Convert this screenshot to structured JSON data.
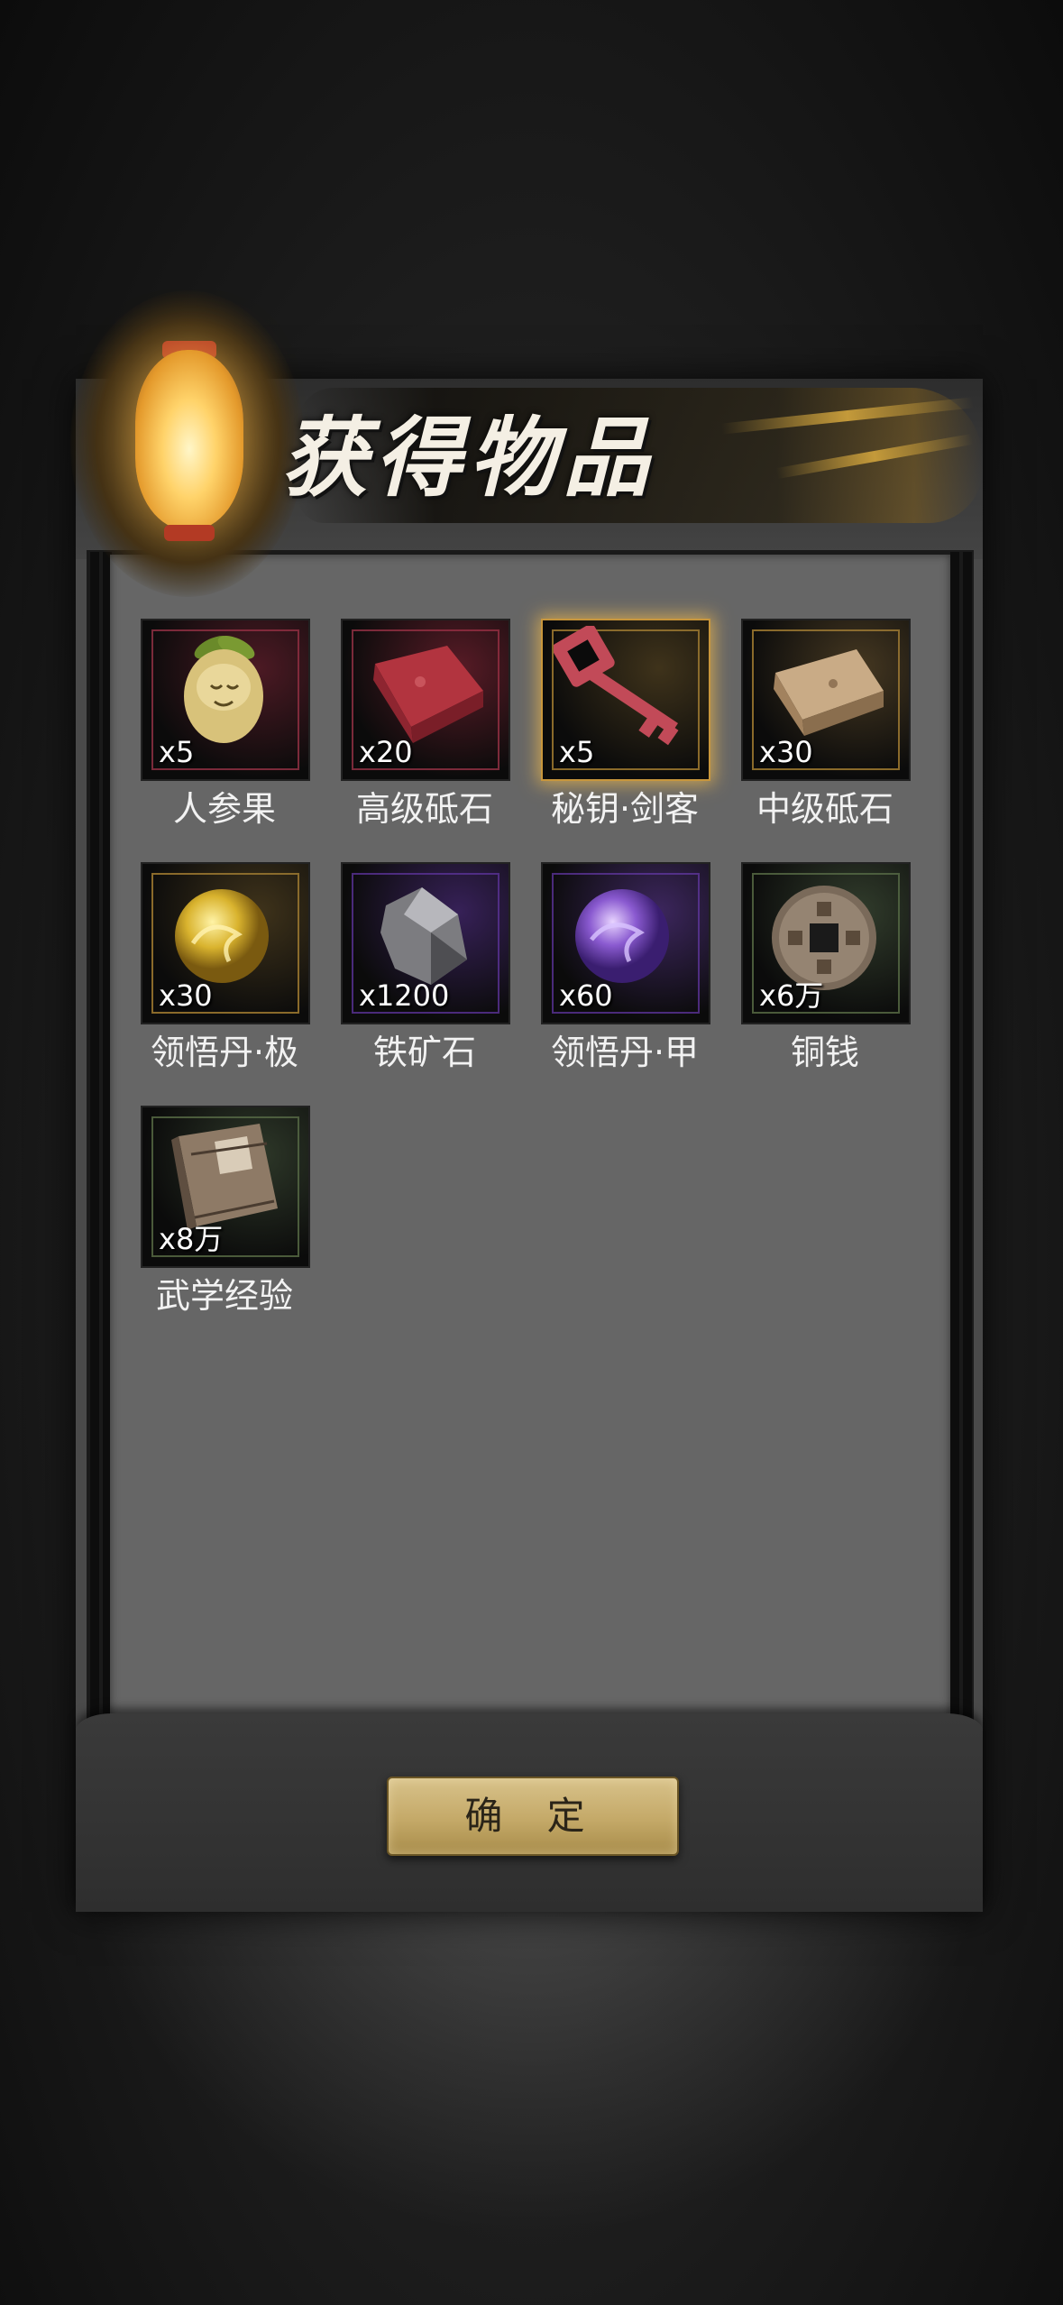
{
  "dialog": {
    "title": "获得物品",
    "confirm_label": "确 定"
  },
  "items": [
    {
      "name": "人参果",
      "count": "x5",
      "icon": "ginseng-fruit-icon"
    },
    {
      "name": "高级砥石",
      "count": "x20",
      "icon": "red-whetstone-icon"
    },
    {
      "name": "秘钥·剑客",
      "count": "x5",
      "icon": "key-icon"
    },
    {
      "name": "中级砥石",
      "count": "x30",
      "icon": "whetstone-icon"
    },
    {
      "name": "领悟丹·极",
      "count": "x30",
      "icon": "gold-pill-icon"
    },
    {
      "name": "铁矿石",
      "count": "x1200",
      "icon": "iron-ore-icon"
    },
    {
      "name": "领悟丹·甲",
      "count": "x60",
      "icon": "purple-pill-icon"
    },
    {
      "name": "铜钱",
      "count": "x6万",
      "icon": "copper-coin-icon"
    },
    {
      "name": "武学经验",
      "count": "x8万",
      "icon": "martial-book-icon"
    }
  ],
  "colors": {
    "frame_red": "#7a2a3a",
    "frame_gold": "#8a6a2a",
    "frame_purple": "#4a2a7a",
    "frame_green": "#4a5a3a",
    "button_gold": "#c4a968"
  }
}
